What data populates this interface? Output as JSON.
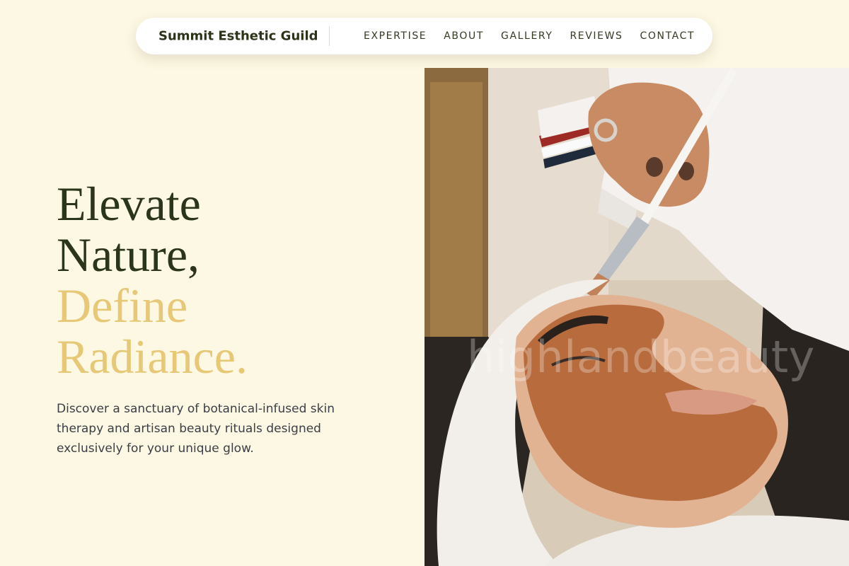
{
  "nav": {
    "brand": "Summit Esthetic Guild",
    "links": [
      "EXPERTISE",
      "ABOUT",
      "GALLERY",
      "REVIEWS",
      "CONTACT"
    ]
  },
  "hero": {
    "headline_lines": [
      "Elevate",
      "Nature,"
    ],
    "headline_accent_lines": [
      "Define",
      "Radiance."
    ],
    "intro": "Discover a sanctuary of botanical-infused skin therapy and artisan beauty rituals designed exclusively for your unique glow.",
    "photo_watermark": "highlandbeauty"
  },
  "colors": {
    "background": "#fdf8e3",
    "headline": "#2b3519",
    "accent": "#e6c877",
    "body_text": "#3a3f47"
  }
}
